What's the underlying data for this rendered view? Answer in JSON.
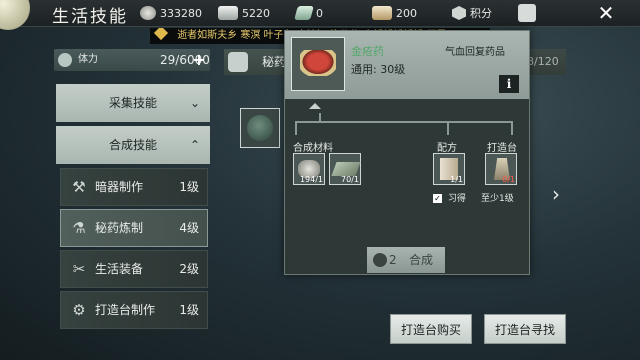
{
  "header": {
    "title": "生活技能",
    "resources": [
      {
        "icon": "coin-icon",
        "value": "333280"
      },
      {
        "icon": "silver-ingot-icon",
        "value": "5220"
      },
      {
        "icon": "jade-icon",
        "value": "0"
      },
      {
        "icon": "gold-ingot-icon",
        "value": "200"
      },
      {
        "icon": "points-badge-icon",
        "value": "积分"
      }
    ]
  },
  "ticker": {
    "text": "逝者如斯夫乡 寒溟 叶子鱼 白沐知 柳依依 南栀栀栀栀栀 细雪"
  },
  "stamina": {
    "label": "体力",
    "value": "29/6000",
    "plus": "+"
  },
  "menu": {
    "categories": [
      {
        "label": "采集技能",
        "chevron": "⌄"
      },
      {
        "label": "合成技能",
        "chevron": "⌃"
      }
    ],
    "skills": [
      {
        "name": "暗器制作",
        "level": "1级",
        "icon": "⚒"
      },
      {
        "name": "秘药炼制",
        "level": "4级",
        "icon": "⚗"
      },
      {
        "name": "生活装备",
        "level": "2级",
        "icon": "✂"
      },
      {
        "name": "打造台制作",
        "level": "1级",
        "icon": "⚙"
      }
    ]
  },
  "recipe_tab": {
    "label": "秘药",
    "count": "98/120"
  },
  "popup": {
    "item_name": "金疮药",
    "item_sub": "通用: 30级",
    "effect": "气血回复药品",
    "info": "i",
    "labels": {
      "materials": "合成材料",
      "recipe": "配方",
      "bench": "打造台"
    },
    "materials": [
      {
        "count": "194/1"
      },
      {
        "count": "70/1"
      }
    ],
    "recipe_count": "1/1",
    "bench_count": "0/1",
    "learned": "习得",
    "learned_check": "✓",
    "bench_req": "至少1级",
    "combine": {
      "cost": "2",
      "label": "合成"
    }
  },
  "buttons": {
    "buy": "打造台购买",
    "find": "打造台寻找"
  },
  "nav": {
    "next": "›",
    "close": "✕"
  }
}
